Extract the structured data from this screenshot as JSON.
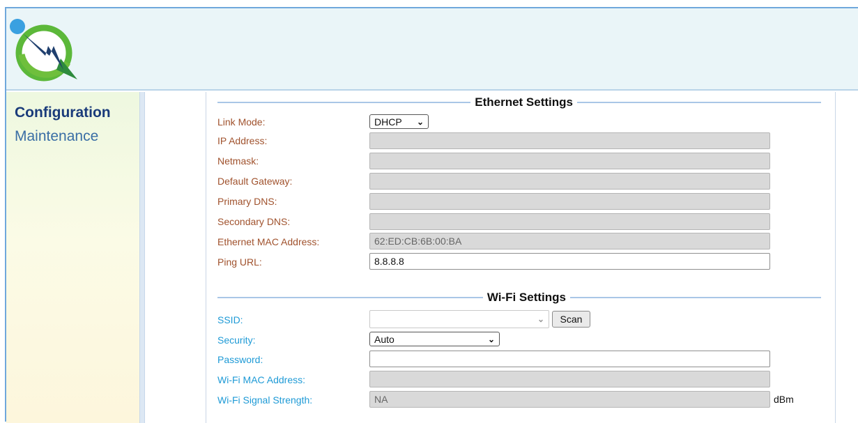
{
  "nav": {
    "items": [
      {
        "label": "Configuration"
      },
      {
        "label": "Maintenance"
      }
    ]
  },
  "ethernet": {
    "title": "Ethernet Settings",
    "link_mode": {
      "label": "Link Mode:",
      "value": "DHCP"
    },
    "ip_address": {
      "label": "IP Address:",
      "value": ""
    },
    "netmask": {
      "label": "Netmask:",
      "value": ""
    },
    "gateway": {
      "label": "Default Gateway:",
      "value": ""
    },
    "primary_dns": {
      "label": "Primary DNS:",
      "value": ""
    },
    "secondary_dns": {
      "label": "Secondary DNS:",
      "value": ""
    },
    "mac": {
      "label": "Ethernet MAC Address:",
      "value": "62:ED:CB:6B:00:BA"
    },
    "ping": {
      "label": "Ping URL:",
      "value": "8.8.8.8"
    }
  },
  "wifi": {
    "title": "Wi-Fi Settings",
    "ssid": {
      "label": "SSID:",
      "value": ""
    },
    "scan_label": "Scan",
    "security": {
      "label": "Security:",
      "value": "Auto"
    },
    "password": {
      "label": "Password:",
      "value": ""
    },
    "mac": {
      "label": "Wi-Fi MAC Address:",
      "value": ""
    },
    "signal": {
      "label": "Wi-Fi Signal Strength:",
      "value": "NA",
      "unit": "dBm"
    }
  },
  "colors": {
    "eth_label": "#a0522d",
    "wifi_label": "#1e9ad6",
    "header_bg": "#eaf5f8"
  }
}
